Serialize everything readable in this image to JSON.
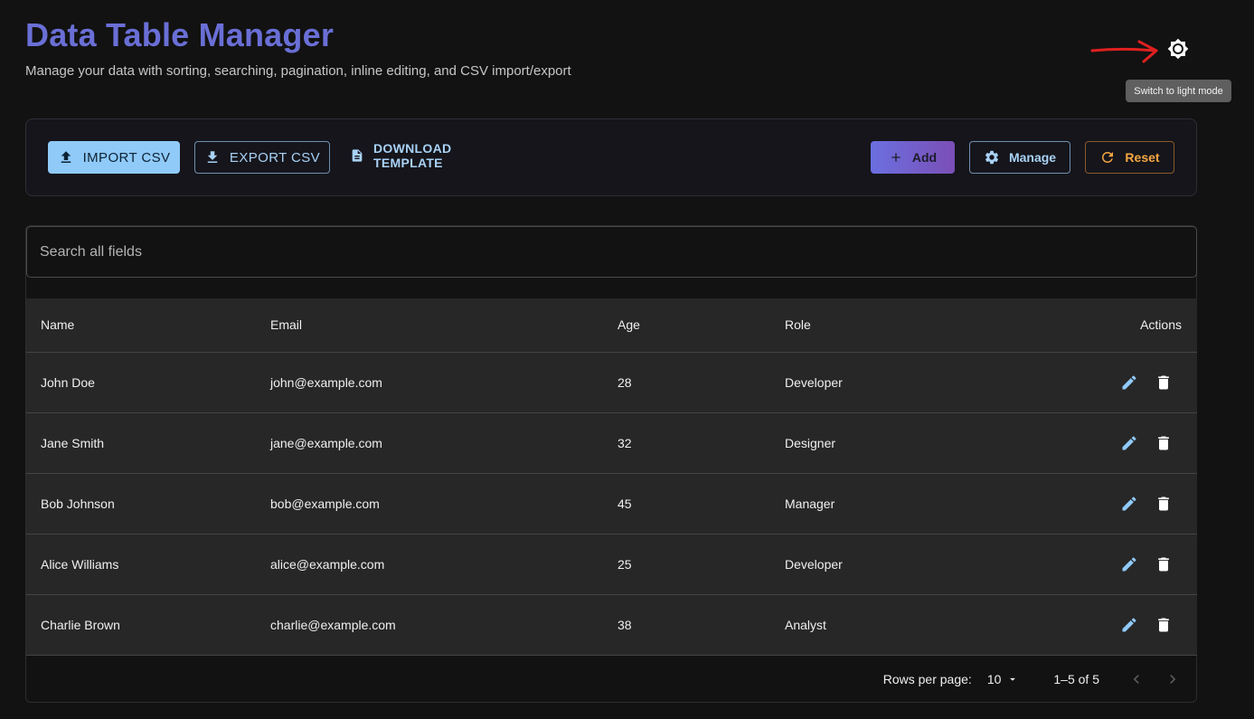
{
  "header": {
    "title": "Data Table Manager",
    "subtitle": "Manage your data with sorting, searching, pagination, inline editing, and CSV import/export",
    "theme_tooltip": "Switch to light mode"
  },
  "toolbar": {
    "import_label": "IMPORT CSV",
    "export_label": "EXPORT CSV",
    "template_label": "DOWNLOAD TEMPLATE",
    "add_label": "Add",
    "manage_label": "Manage",
    "reset_label": "Reset"
  },
  "search": {
    "placeholder": "Search all fields"
  },
  "table": {
    "columns": [
      "Name",
      "Email",
      "Age",
      "Role",
      "Actions"
    ],
    "rows": [
      [
        "John Doe",
        "john@example.com",
        "28",
        "Developer"
      ],
      [
        "Jane Smith",
        "jane@example.com",
        "32",
        "Designer"
      ],
      [
        "Bob Johnson",
        "bob@example.com",
        "45",
        "Manager"
      ],
      [
        "Alice Williams",
        "alice@example.com",
        "25",
        "Developer"
      ],
      [
        "Charlie Brown",
        "charlie@example.com",
        "38",
        "Analyst"
      ]
    ]
  },
  "pagination": {
    "rows_per_page_label": "Rows per page:",
    "rows_per_page": "10",
    "range": "1–5 of 5"
  },
  "icons": {
    "theme": "sun-icon",
    "upload": "upload-icon",
    "download": "download-icon",
    "file": "file-icon",
    "add": "plus-icon",
    "manage": "gear-icon",
    "reset": "refresh-icon",
    "edit": "pencil-icon",
    "delete": "trash-icon"
  },
  "colors": {
    "title": "#6a6fd6",
    "primary": "#90caf9",
    "reset": "#f5a742",
    "background": "#121212"
  }
}
